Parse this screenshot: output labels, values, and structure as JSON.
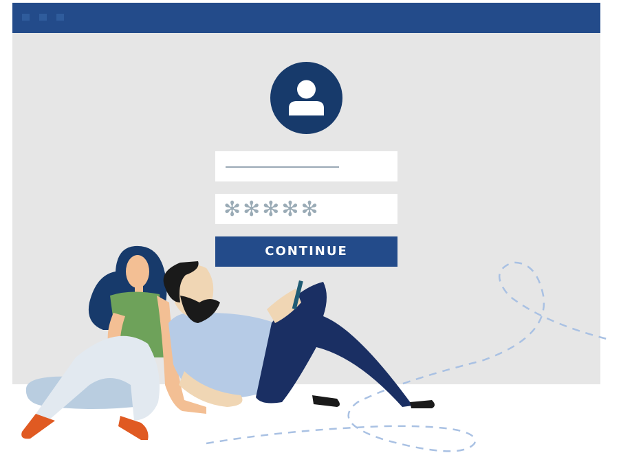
{
  "window": {
    "titlebar_color": "#234b8a",
    "background_color": "#e6e6e6"
  },
  "login": {
    "avatar_icon": "user-icon",
    "password_mask": "✻✻✻✻✻",
    "continue_label": "CONTINUE"
  },
  "colors": {
    "accent": "#234b8a",
    "avatar": "#173a6b"
  }
}
